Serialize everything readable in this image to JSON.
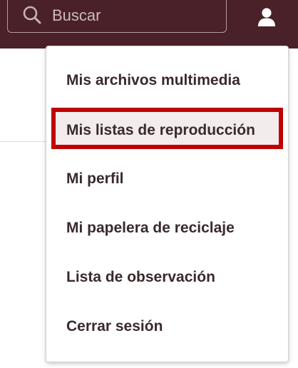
{
  "header": {
    "search": {
      "placeholder": "Buscar",
      "icon": "search-icon"
    },
    "user_menu_icon": "user-icon",
    "background_color": "#4a2128"
  },
  "user_menu": {
    "items": [
      {
        "label": "Mis archivos multimedia"
      },
      {
        "label": "Mis listas de reproducción",
        "highlighted": true
      },
      {
        "label": "Mi perfil"
      },
      {
        "label": "Mi papelera de reciclaje"
      },
      {
        "label": "Lista de observación"
      },
      {
        "label": "Cerrar sesión"
      }
    ],
    "highlight_color": "#c00000"
  }
}
